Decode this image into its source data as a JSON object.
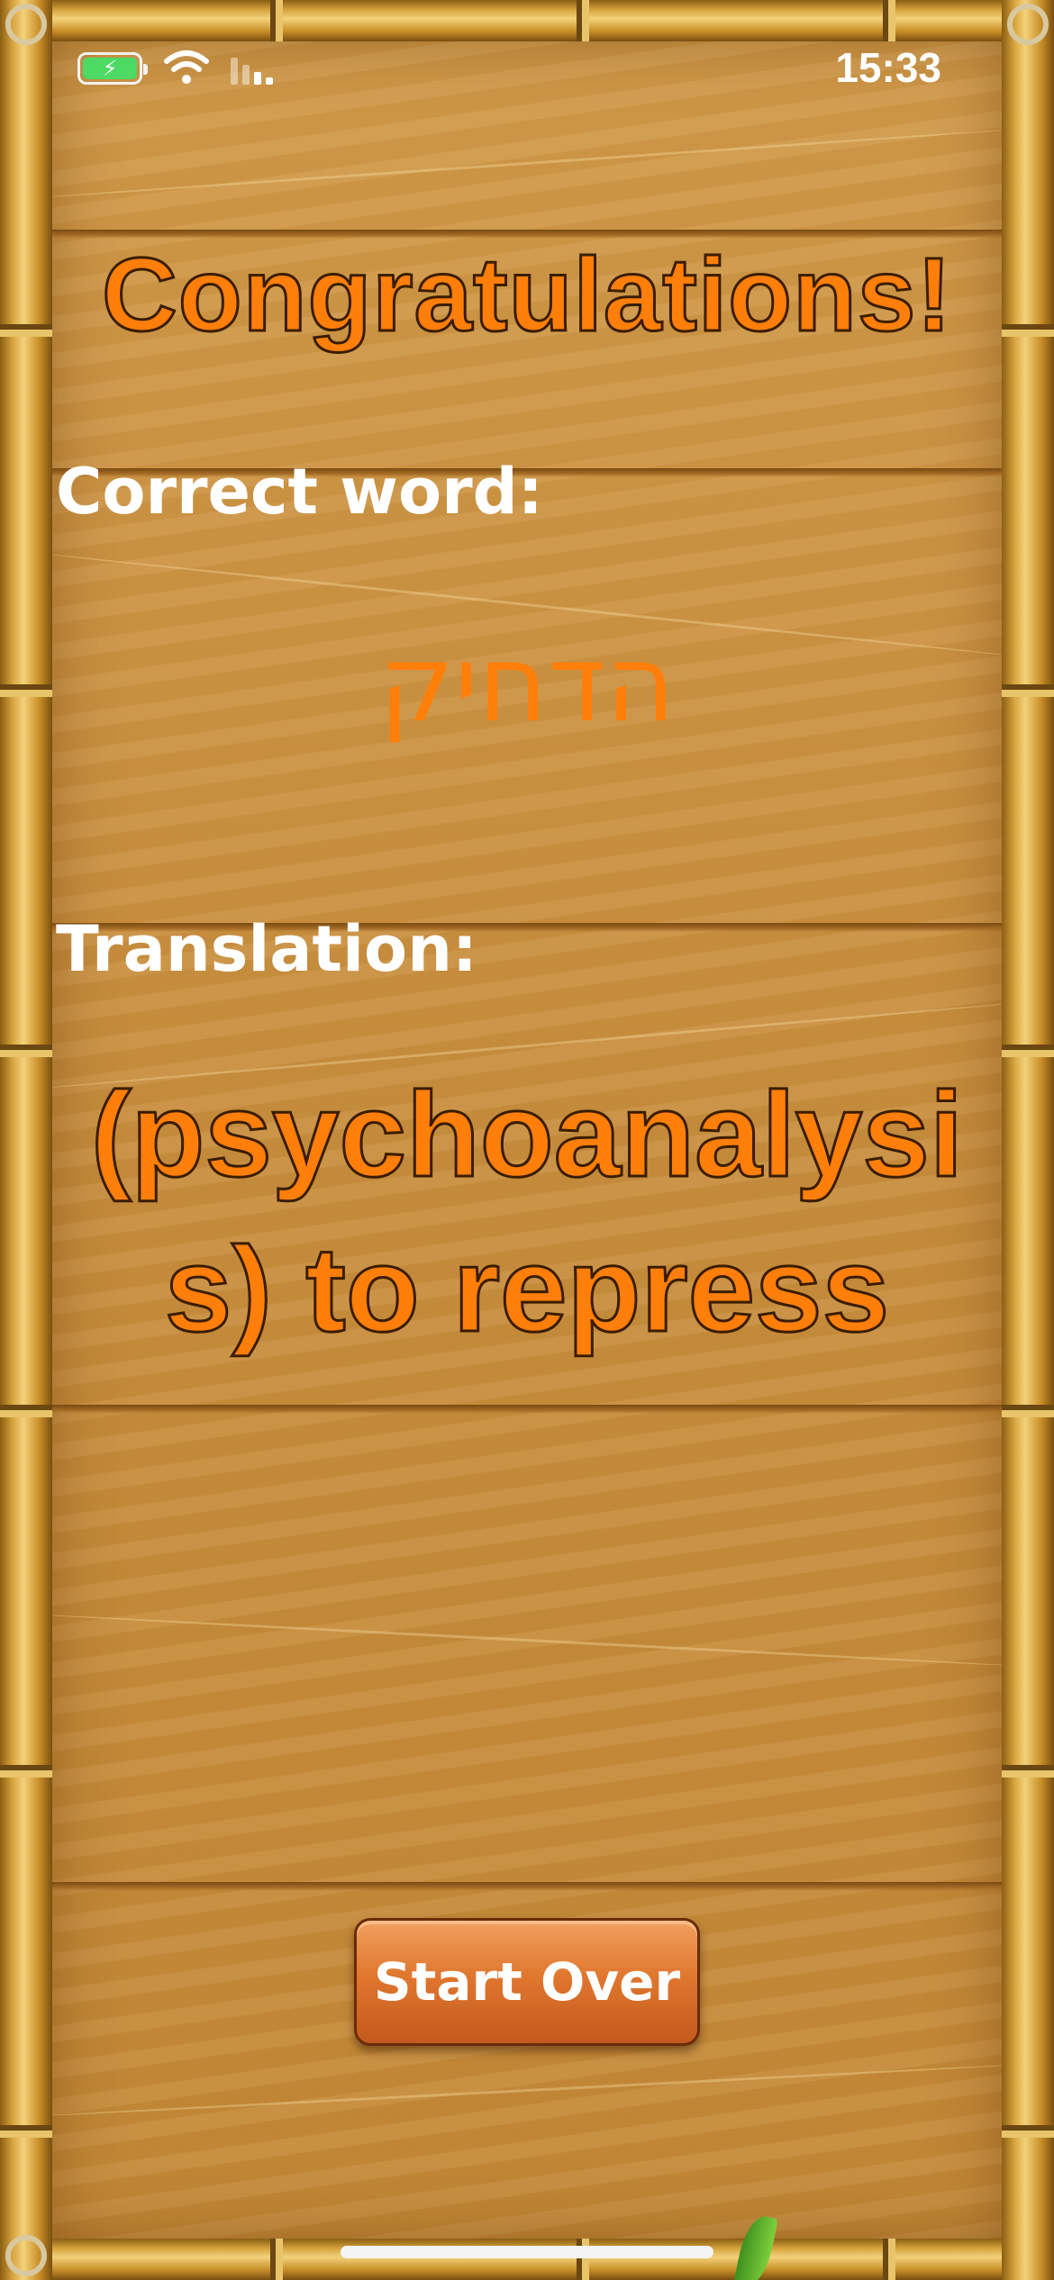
{
  "status_bar": {
    "time": "15:33",
    "battery_icon": "battery-charging-icon",
    "battery_color": "#4cd964",
    "wifi_icon": "wifi-icon",
    "signal_icon": "cellular-signal-icon"
  },
  "result": {
    "title": "Congratulations!",
    "correct_word_label": "Correct word:",
    "correct_word": "הדחיק",
    "translation_label": "Translation:",
    "translation": "(psychoanalysis) to repress"
  },
  "actions": {
    "start_over_label": "Start Over"
  },
  "colors": {
    "accent": "#ff7f0a",
    "label": "#ffffff",
    "button": "#e0772f"
  }
}
